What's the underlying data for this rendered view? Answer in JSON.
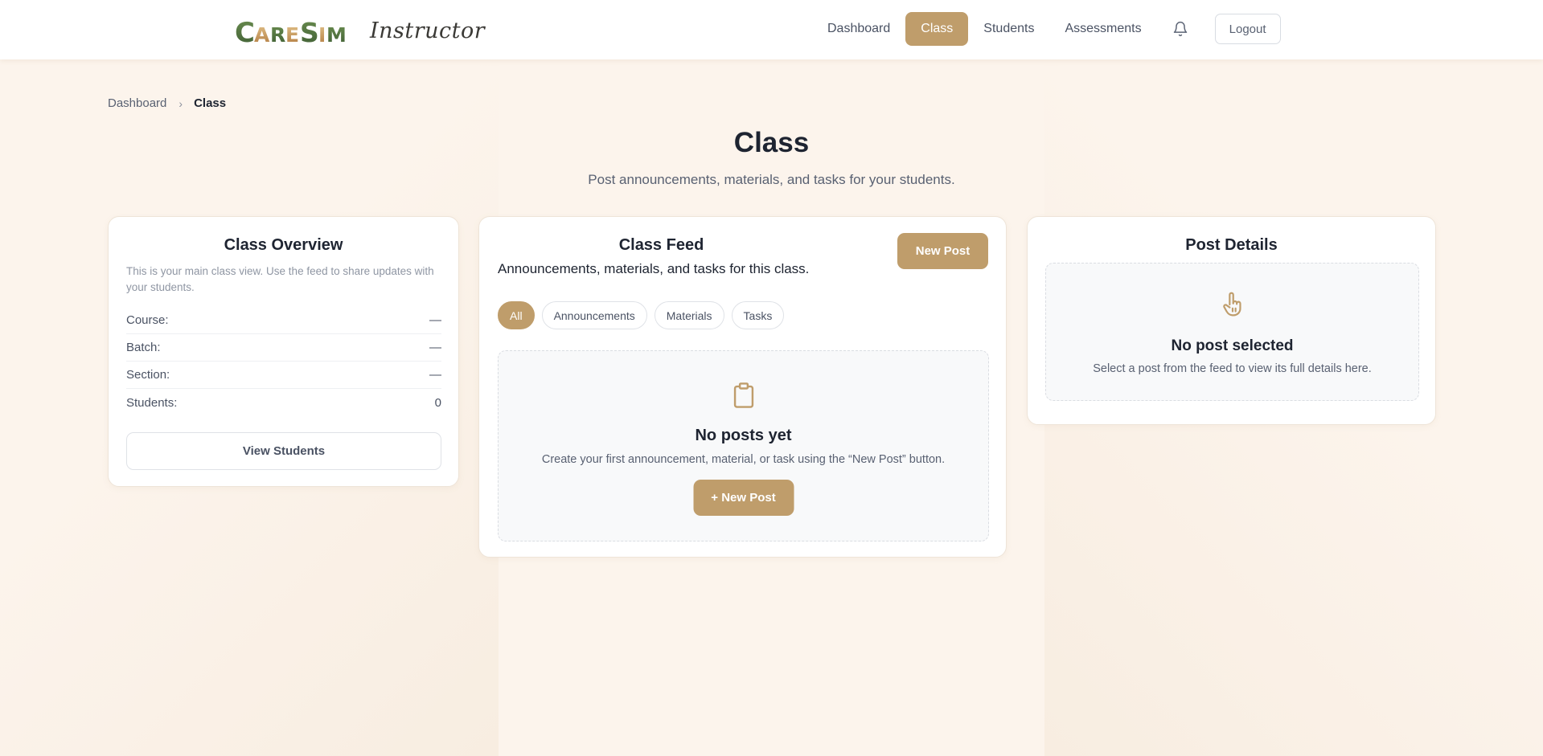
{
  "header": {
    "brand_name": "CareSim",
    "brand_role": "Instructor",
    "nav": [
      {
        "label": "Dashboard",
        "active": false
      },
      {
        "label": "Class",
        "active": true
      },
      {
        "label": "Students",
        "active": false
      },
      {
        "label": "Assessments",
        "active": false
      }
    ],
    "bell_icon": "bell-icon",
    "logout_label": "Logout"
  },
  "breadcrumb": {
    "root": "Dashboard",
    "separator": "›",
    "current": "Class"
  },
  "page": {
    "title": "Class",
    "subtitle": "Post announcements, materials, and tasks for your students."
  },
  "overview": {
    "title": "Class Overview",
    "description": "This is your main class view. Use the feed to share updates with your students.",
    "rows": [
      {
        "label": "Course:",
        "value": "—"
      },
      {
        "label": "Batch:",
        "value": "—"
      },
      {
        "label": "Section:",
        "value": "—"
      },
      {
        "label": "Students:",
        "value": "0"
      }
    ],
    "view_students_label": "View Students"
  },
  "feed": {
    "title": "Class Feed",
    "subtitle": "Announcements, materials, and tasks for this class.",
    "new_post_label": "New Post",
    "filters": [
      {
        "label": "All",
        "active": true
      },
      {
        "label": "Announcements",
        "active": false
      },
      {
        "label": "Materials",
        "active": false
      },
      {
        "label": "Tasks",
        "active": false
      }
    ],
    "empty": {
      "icon": "clipboard-icon",
      "title": "No posts yet",
      "text": "Create your first announcement, material, or task using the “New Post” button.",
      "button_label": "+ New Post"
    }
  },
  "details": {
    "title": "Post Details",
    "empty": {
      "icon": "pointing-hand-icon",
      "title": "No post selected",
      "text": "Select a post from the feed to view its full details here."
    }
  },
  "colors": {
    "accent": "#bf9d6b",
    "page_background": "#fcf4ec",
    "text_dark": "#1e2431",
    "text_muted": "#596172"
  }
}
